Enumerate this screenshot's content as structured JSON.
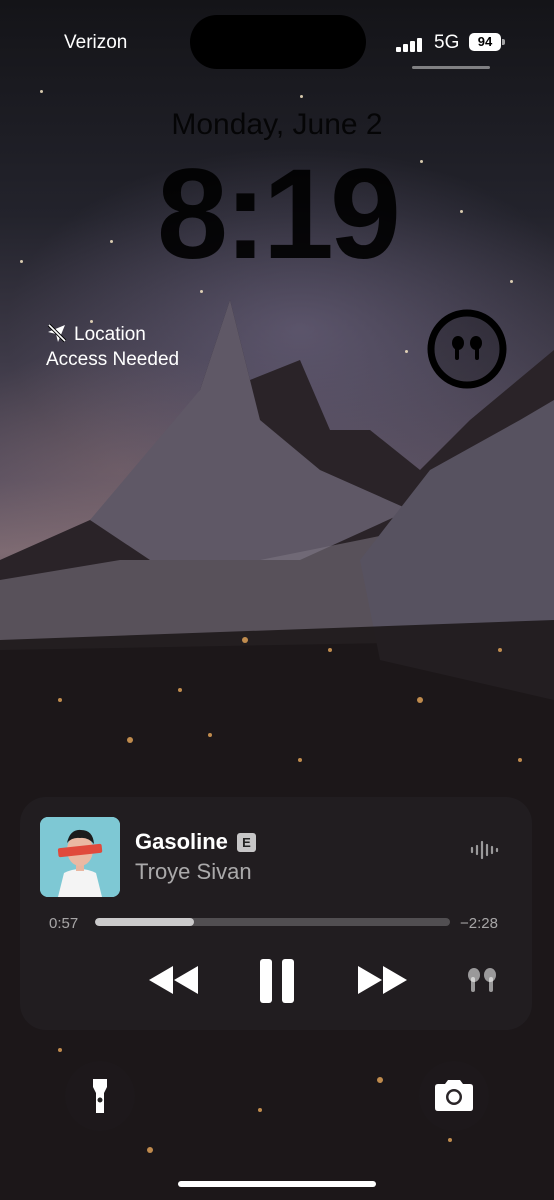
{
  "status_bar": {
    "carrier": "Verizon",
    "network": "5G",
    "battery_level": "94",
    "signal_bars": 4
  },
  "lock_screen": {
    "date": "Monday, June 2",
    "time": "8:19"
  },
  "widgets": {
    "location": {
      "line1": "Location",
      "line2": "Access Needed",
      "icon": "location-slash-icon"
    },
    "airpods": {
      "icon": "airpods-icon"
    }
  },
  "now_playing": {
    "song": "Gasoline",
    "explicit_badge": "E",
    "artist": "Troye Sivan",
    "elapsed": "0:57",
    "remaining": "−2:28",
    "progress": 0.28,
    "album_art_text": "TROYE",
    "controls": {
      "rewind": "rewind-icon",
      "pause": "pause-icon",
      "forward": "fast-forward-icon",
      "output": "airpods-icon"
    }
  },
  "quick_actions": {
    "left": "flashlight-icon",
    "right": "camera-icon"
  }
}
